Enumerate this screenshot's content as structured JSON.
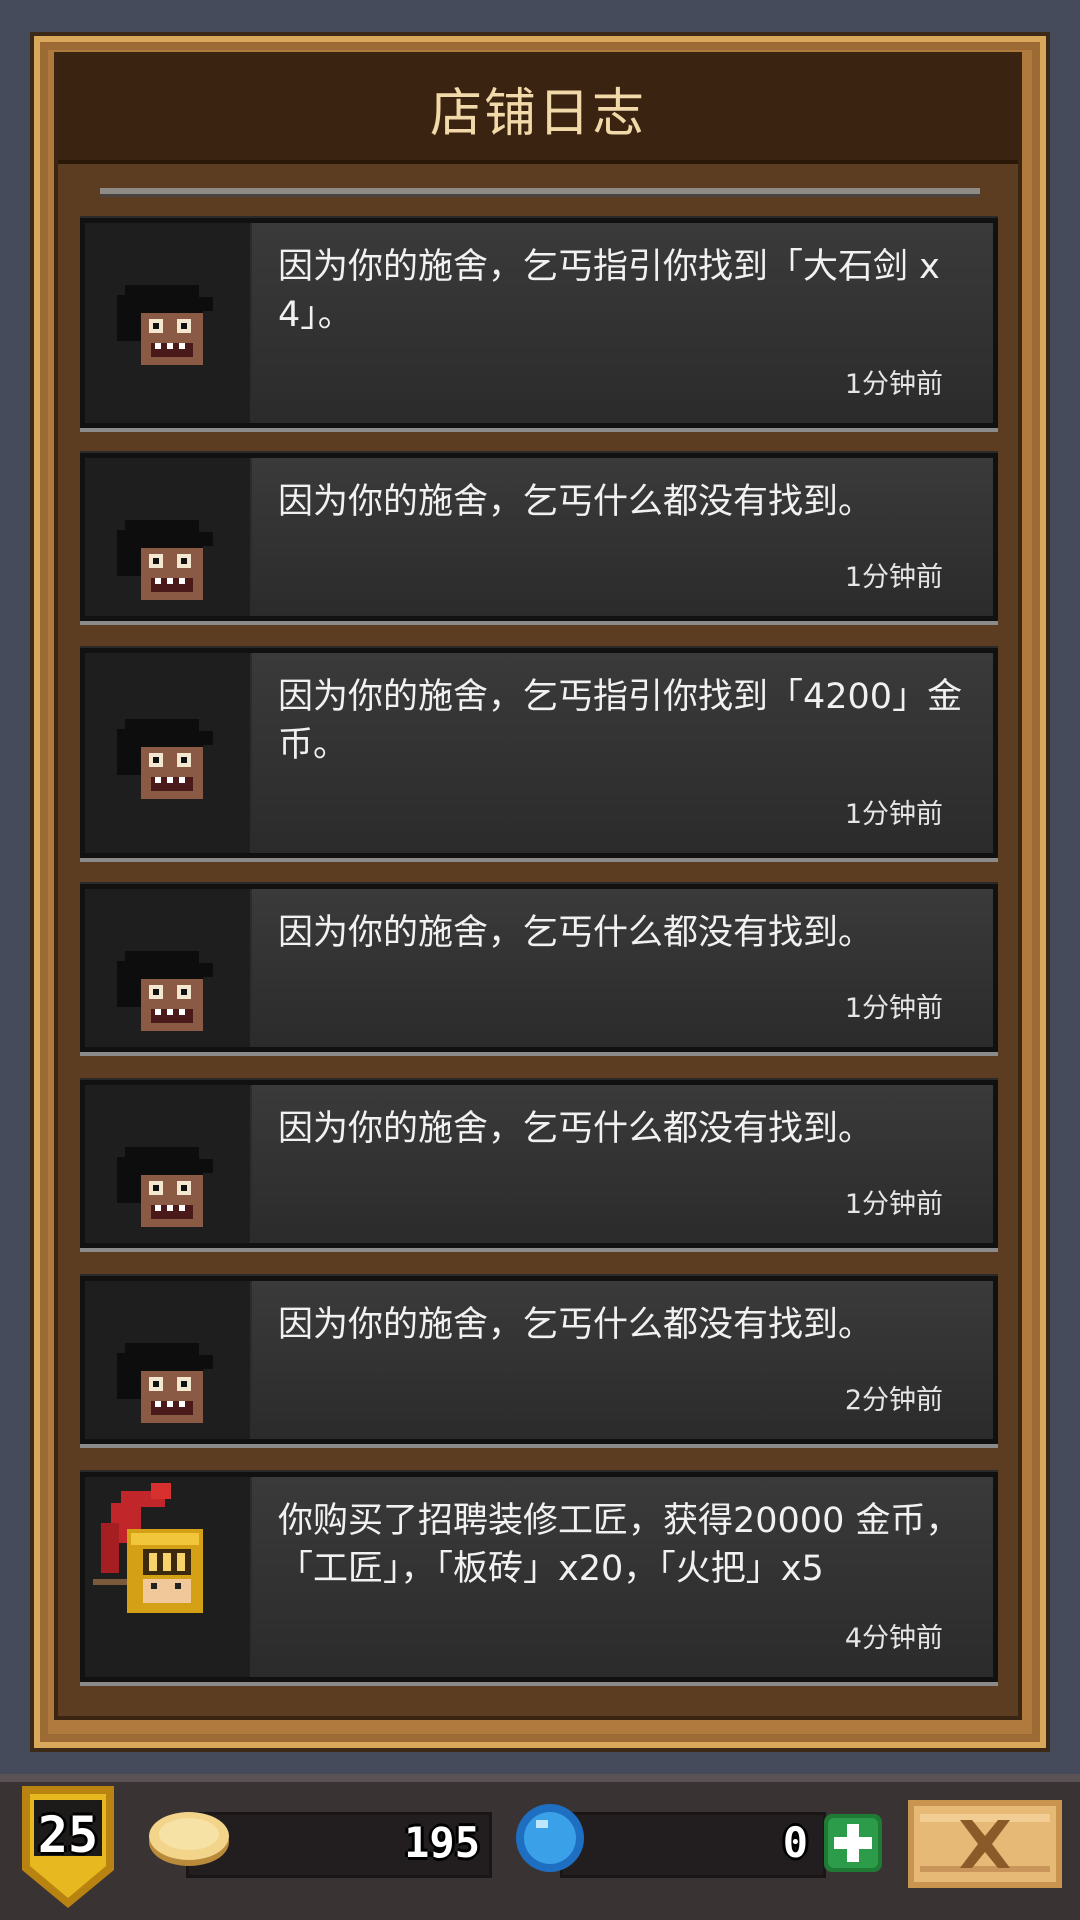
{
  "panel": {
    "title": "店铺日志"
  },
  "entries": [
    {
      "portrait": "beggar-portrait",
      "message": "因为你的施舍，乞丐指引你找到「大石剑 x 4」。",
      "time": "1分钟前"
    },
    {
      "portrait": "beggar-portrait",
      "message": "因为你的施舍，乞丐什么都没有找到。",
      "time": "1分钟前"
    },
    {
      "portrait": "beggar-portrait",
      "message": "因为你的施舍，乞丐指引你找到「4200」金币。",
      "time": "1分钟前"
    },
    {
      "portrait": "beggar-portrait",
      "message": "因为你的施舍，乞丐什么都没有找到。",
      "time": "1分钟前"
    },
    {
      "portrait": "beggar-portrait",
      "message": "因为你的施舍，乞丐什么都没有找到。",
      "time": "1分钟前"
    },
    {
      "portrait": "beggar-portrait",
      "message": "因为你的施舍，乞丐什么都没有找到。",
      "time": "2分钟前"
    },
    {
      "portrait": "craftsman-knight-portrait",
      "message": "你购买了招聘装修工匠，获得20000 金币，「工匠」，「板砖」x20，「火把」x5",
      "time": "4分钟前"
    }
  ],
  "status_bar": {
    "level": "25",
    "gold": "195",
    "gems": "0",
    "icons": {
      "level": "shield-badge-icon",
      "gold": "gold-coin-icon",
      "gems": "blue-gem-icon",
      "add": "plus-icon",
      "close": "close-x-icon"
    }
  },
  "colors": {
    "frame": "#d9a85b",
    "panel_bg": "#5c3d22",
    "header_bg": "#3a2411",
    "title_text": "#f1d9a9",
    "entry_bg": "#2f2f2f",
    "add_button": "#2d9c4a",
    "gem": "#3aa0e8"
  }
}
